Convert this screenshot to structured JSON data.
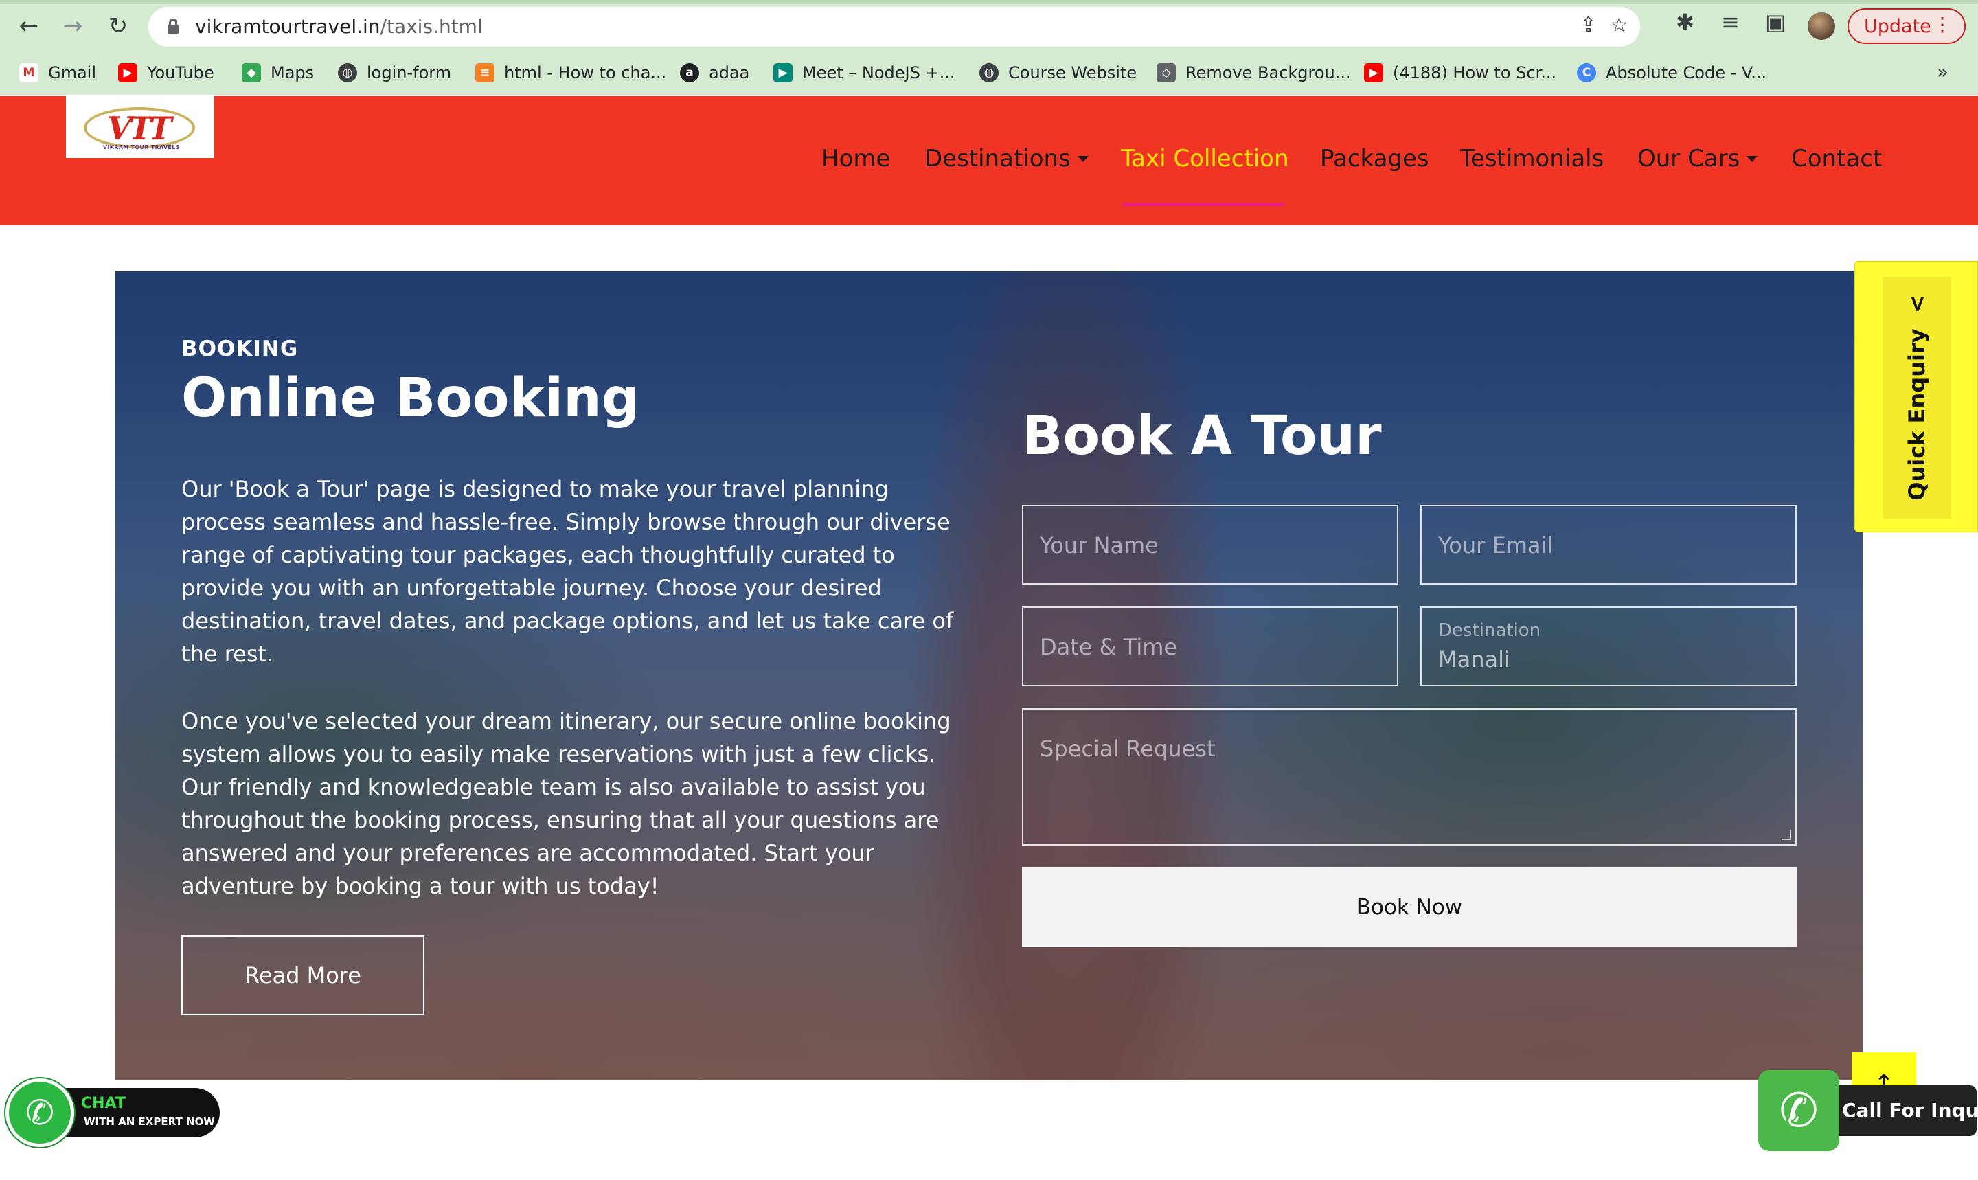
{
  "browser": {
    "url_domain": "vikramtourtravel.in",
    "url_path": "/taxis.html",
    "update_label": "Update",
    "bookmarks": [
      {
        "label": "Gmail",
        "icon": "gmail-icon"
      },
      {
        "label": "YouTube",
        "icon": "youtube-icon"
      },
      {
        "label": "Maps",
        "icon": "maps-icon"
      },
      {
        "label": "login-form",
        "icon": "globe-icon"
      },
      {
        "label": "html - How to cha...",
        "icon": "stackoverflow-icon"
      },
      {
        "label": "adaa",
        "icon": "adaa-icon"
      },
      {
        "label": "Meet – NodeJS +...",
        "icon": "meet-icon"
      },
      {
        "label": "Course Website",
        "icon": "globe-icon"
      },
      {
        "label": "Remove Backgrou...",
        "icon": "removebg-icon"
      },
      {
        "label": "(4188) How to Scr...",
        "icon": "youtube-icon"
      },
      {
        "label": "Absolute Code - V...",
        "icon": "absolute-code-icon"
      }
    ]
  },
  "site": {
    "logo_mark": "VTT",
    "logo_sub": "VIKRAM TOUR TRAVELS",
    "nav": {
      "home": "Home",
      "destinations": "Destinations",
      "taxi": "Taxi Collection",
      "packages": "Packages",
      "testimonials": "Testimonials",
      "cars": "Our Cars",
      "contact": "Contact"
    },
    "active_nav": "Taxi Collection"
  },
  "booking": {
    "eyebrow": "BOOKING",
    "title": "Online Booking",
    "para1": "Our 'Book a Tour' page is designed to make your travel planning process seamless and hassle-free. Simply browse through our diverse range of captivating tour packages, each thoughtfully curated to provide you with an unforgettable journey. Choose your desired destination, travel dates, and package options, and let us take care of the rest.",
    "para2": "Once you've selected your dream itinerary, our secure online booking system allows you to easily make reservations with just a few clicks. Our friendly and knowledgeable team is also available to assist you throughout the booking process, ensuring that all your questions are answered and your preferences are accommodated. Start your adventure by booking a tour with us today!",
    "read_more": "Read More"
  },
  "form": {
    "title": "Book A Tour",
    "name_placeholder": "Your Name",
    "email_placeholder": "Your Email",
    "datetime_placeholder": "Date & Time",
    "destination_label": "Destination",
    "destination_value": "Manali",
    "request_placeholder": "Special Request",
    "submit": "Book Now"
  },
  "widgets": {
    "quick_enquiry": "Quick Enquiry",
    "quick_enquiry_chevron": "<",
    "chat_line1": "CHAT",
    "chat_line2": "WITH AN EXPERT NOW",
    "call_label": "Call For Inquiry"
  },
  "colors": {
    "header_red": "#ef3424",
    "active_nav_yellow": "#ffe600",
    "active_underline": "#e91e8c",
    "quick_enquiry_yellow": "#ffff33",
    "whatsapp_green": "#2bb741"
  }
}
